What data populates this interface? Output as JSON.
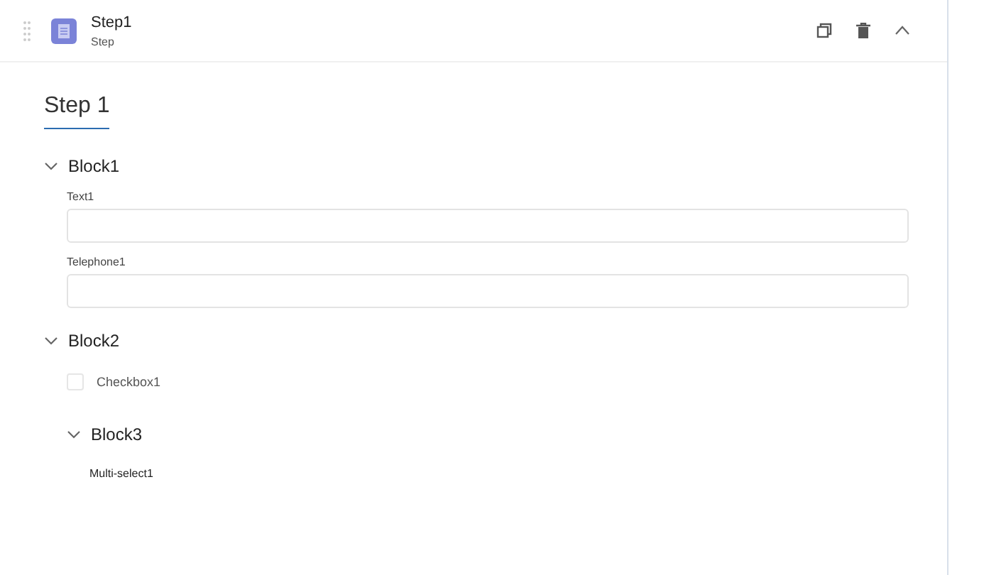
{
  "header": {
    "title": "Step1",
    "subtitle": "Step"
  },
  "step": {
    "heading": "Step 1"
  },
  "blocks": [
    {
      "kind": "block",
      "label": "Block1",
      "expanded": true,
      "children": [
        {
          "kind": "field",
          "label": "Text1"
        },
        {
          "kind": "field",
          "label": "Telephone1"
        }
      ]
    },
    {
      "kind": "block",
      "label": "Block2",
      "expanded": true,
      "children": [
        {
          "kind": "checkbox",
          "label": "Checkbox1",
          "checked": false
        },
        {
          "kind": "block",
          "label": "Block3",
          "expanded": true,
          "children": [
            {
              "kind": "label",
              "label": "Multi-select1"
            }
          ]
        }
      ]
    }
  ]
}
